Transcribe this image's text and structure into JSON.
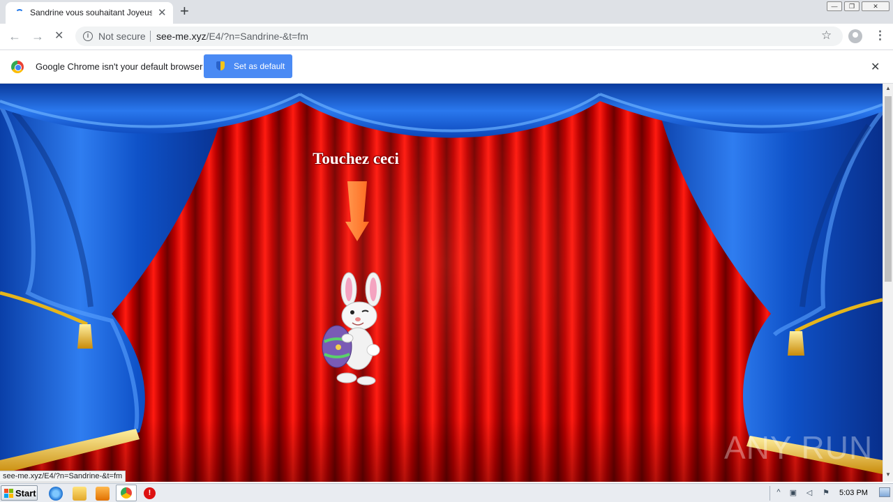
{
  "browser": {
    "tab": {
      "title": "Sandrine vous souhaitant Joyeuses P",
      "close_glyph": "✕"
    },
    "new_tab_glyph": "+",
    "window_controls": {
      "minimize": "—",
      "maximize": "❐",
      "close": "✕"
    },
    "nav": {
      "back": "←",
      "forward": "→",
      "reload": "✕"
    },
    "omnibox": {
      "security_label": "Not secure",
      "url_host": "see-me.xyz",
      "url_path": "/E4/?n=Sandrine-&t=fm"
    },
    "star_glyph": "☆",
    "menu_glyph": "⋮",
    "infobar": {
      "message": "Google Chrome isn't your default browser",
      "button_label": "Set as default",
      "close_glyph": "✕"
    }
  },
  "page": {
    "touch_text": "Touchez ceci",
    "watermark": "ANY RUN"
  },
  "status_bubble": "see-me.xyz/E4/?n=Sandrine-&t=fm",
  "taskbar": {
    "start_label": "Start",
    "clock": "5:03 PM",
    "tray_glyphs": {
      "expand": "^",
      "network": "▣",
      "volume": "◁",
      "flag": "⚑"
    }
  },
  "colors": {
    "curtain_blue": "#1e5fd8",
    "curtain_red": "#c00000",
    "fringe_gold": "#e5b51c",
    "arrow_orange": "#ff7a30",
    "accent_button": "#4a8af4"
  }
}
